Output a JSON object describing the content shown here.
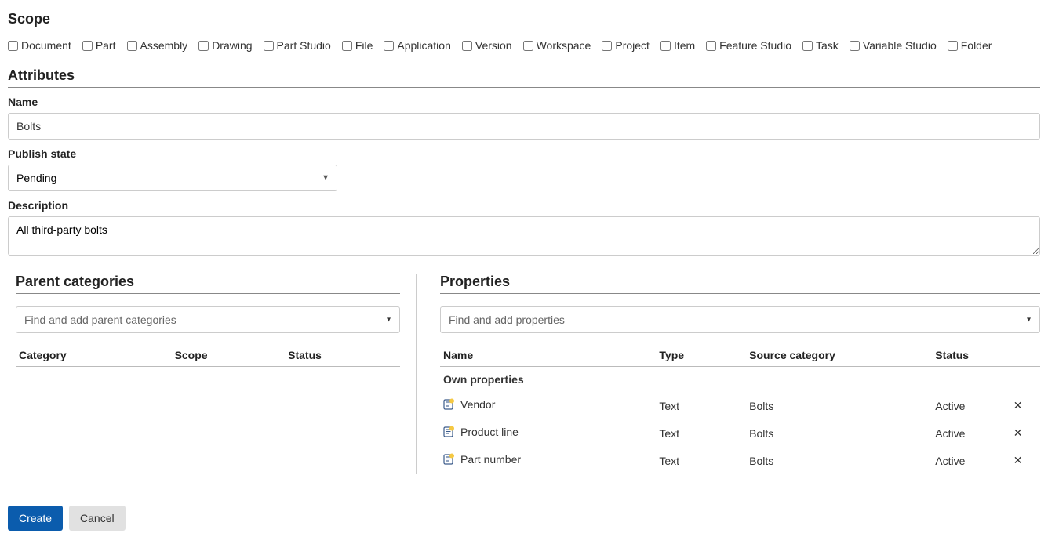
{
  "scope": {
    "title": "Scope",
    "items": [
      {
        "label": "Document",
        "checked": false
      },
      {
        "label": "Part",
        "checked": false
      },
      {
        "label": "Assembly",
        "checked": false
      },
      {
        "label": "Drawing",
        "checked": false
      },
      {
        "label": "Part Studio",
        "checked": false
      },
      {
        "label": "File",
        "checked": false
      },
      {
        "label": "Application",
        "checked": false
      },
      {
        "label": "Version",
        "checked": false
      },
      {
        "label": "Workspace",
        "checked": false
      },
      {
        "label": "Project",
        "checked": false
      },
      {
        "label": "Item",
        "checked": false
      },
      {
        "label": "Feature Studio",
        "checked": false
      },
      {
        "label": "Task",
        "checked": false
      },
      {
        "label": "Variable Studio",
        "checked": false
      },
      {
        "label": "Folder",
        "checked": false
      }
    ]
  },
  "attributes": {
    "title": "Attributes",
    "name_label": "Name",
    "name_value": "Bolts",
    "publish_label": "Publish state",
    "publish_value": "Pending",
    "description_label": "Description",
    "description_value": "All third-party bolts"
  },
  "parent_categories": {
    "title": "Parent categories",
    "combo_placeholder": "Find and add parent categories",
    "columns": [
      "Category",
      "Scope",
      "Status"
    ],
    "rows": []
  },
  "properties": {
    "title": "Properties",
    "combo_placeholder": "Find and add properties",
    "columns": [
      "Name",
      "Type",
      "Source category",
      "Status"
    ],
    "subhead": "Own properties",
    "rows": [
      {
        "name": "Vendor",
        "type": "Text",
        "source": "Bolts",
        "status": "Active"
      },
      {
        "name": "Product line",
        "type": "Text",
        "source": "Bolts",
        "status": "Active"
      },
      {
        "name": "Part number",
        "type": "Text",
        "source": "Bolts",
        "status": "Active"
      }
    ]
  },
  "footer": {
    "create_label": "Create",
    "cancel_label": "Cancel"
  }
}
